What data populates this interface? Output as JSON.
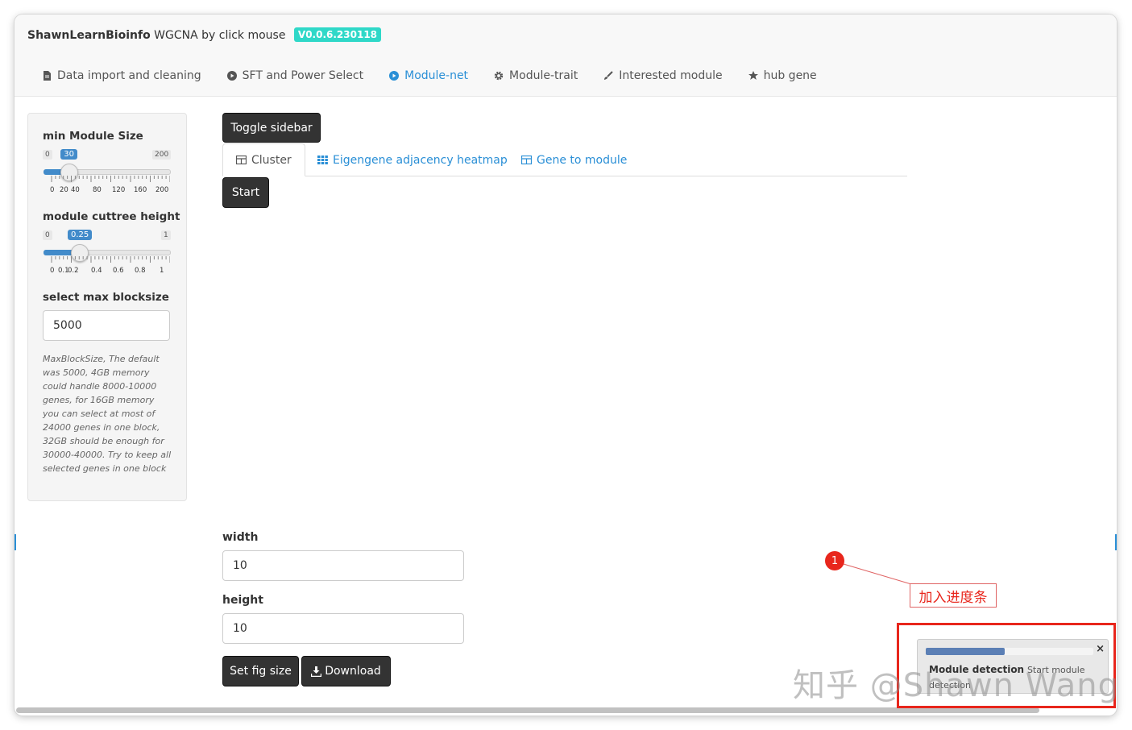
{
  "navbar": {
    "brand_bold": "ShawnLearnBioinfo",
    "brand_rest": " WGCNA by click mouse",
    "version": "V0.0.6.230118",
    "tabs": [
      {
        "label": "Data import and cleaning",
        "icon": "file-icon"
      },
      {
        "label": "SFT and Power Select",
        "icon": "play-circle-icon"
      },
      {
        "label": "Module-net",
        "icon": "play-circle-icon",
        "active": true
      },
      {
        "label": "Module-trait",
        "icon": "gear-icon"
      },
      {
        "label": "Interested module",
        "icon": "brush-icon"
      },
      {
        "label": "hub gene",
        "icon": "star-icon"
      }
    ]
  },
  "sidebar": {
    "min_module_size": {
      "label": "min Module Size",
      "min": "0",
      "max": "200",
      "value": "30",
      "value_fraction": 0.15,
      "ticks": [
        "0",
        "20",
        "40",
        "80",
        "120",
        "160",
        "200"
      ]
    },
    "cuttree_height": {
      "label": "module cuttree height",
      "min": "0",
      "max": "1",
      "value": "0.25",
      "value_fraction": 0.25,
      "ticks": [
        "0",
        "0.1",
        "0.2",
        "0.4",
        "0.6",
        "0.8",
        "1"
      ]
    },
    "max_blocksize": {
      "label": "select max blocksize",
      "value": "5000"
    },
    "help_text": "MaxBlockSize, The default was 5000, 4GB memory could handle 8000-10000 genes, for 16GB memory you can select at most of 24000 genes in one block, 32GB should be enough for 30000-40000. Try to keep all selected genes in one block"
  },
  "main": {
    "toggle_sidebar": "Toggle sidebar",
    "subtabs": [
      {
        "label": "Cluster",
        "active": true
      },
      {
        "label": "Eigengene adjacency heatmap"
      },
      {
        "label": "Gene to module"
      }
    ],
    "start_button": "Start",
    "width_label": "width",
    "width_value": "10",
    "height_label": "height",
    "height_value": "10",
    "set_fig_size": "Set fig size",
    "download": "Download"
  },
  "annotation": {
    "number": "1",
    "text": "加入进度条"
  },
  "notification": {
    "progress": 0.47,
    "title": "Module detection",
    "detail": "Start module detection",
    "close": "×"
  },
  "watermark": "知乎 @Shawn Wang",
  "colors": {
    "accent": "#2a8fd6",
    "version_badge": "#2fd8c8",
    "slider_fill": "#428bca",
    "button_dark": "#333333",
    "annotation_red": "#e8261c",
    "progress_fill": "#5b7fb5"
  }
}
